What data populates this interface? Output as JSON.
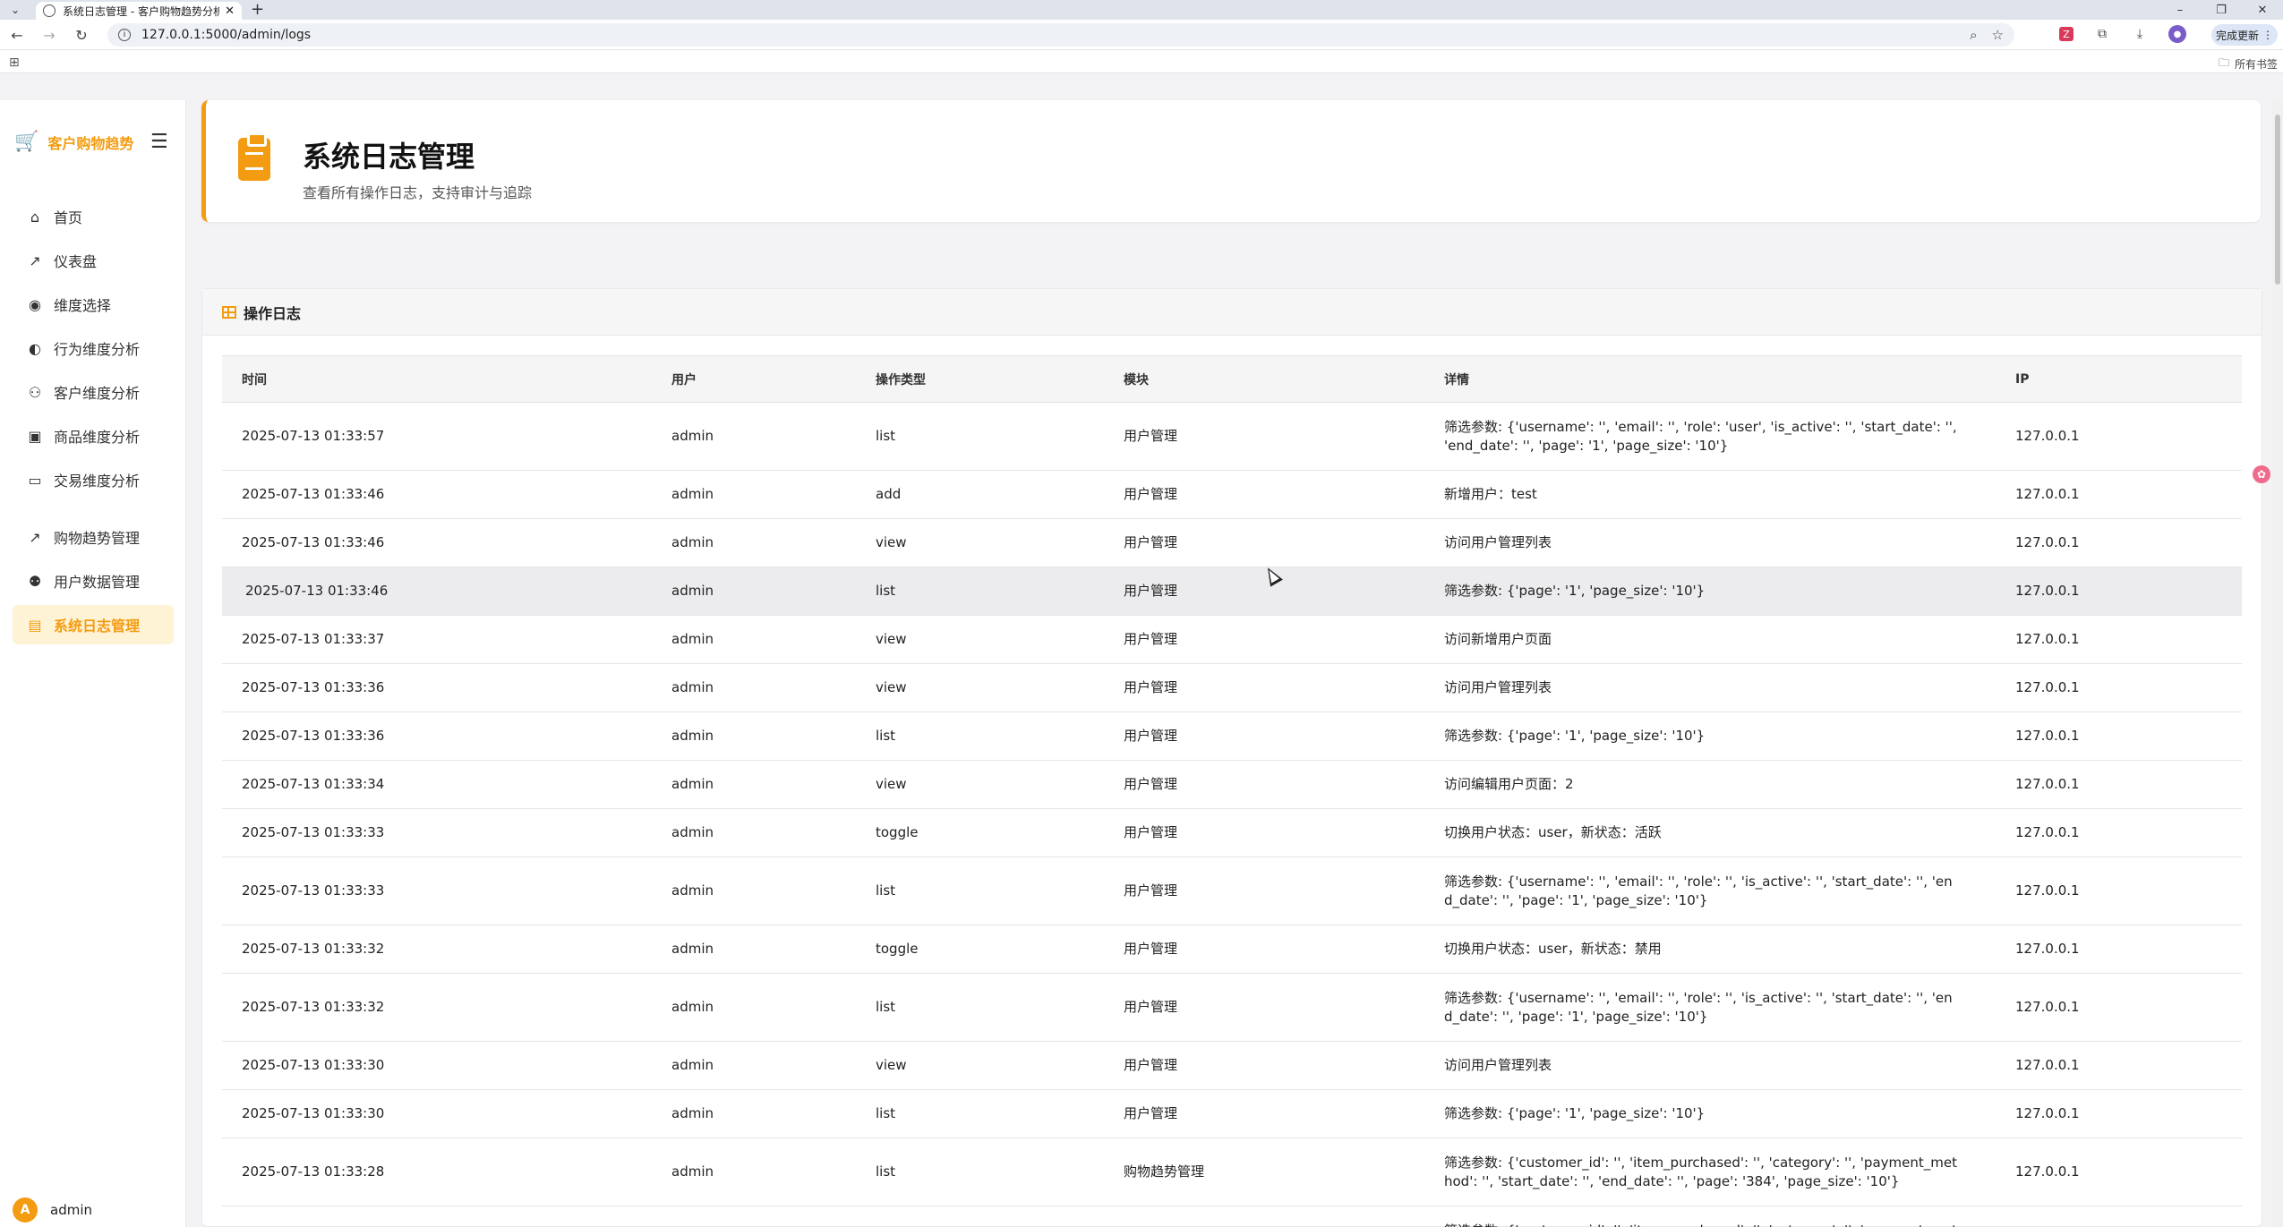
{
  "browser": {
    "tab_title": "系统日志管理 - 客户购物趋势分析",
    "tab_close": "✕",
    "new_tab": "+",
    "url": "127.0.0.1:5000/admin/logs",
    "update_label": "完成更新",
    "bookmarks_label": "所有书签"
  },
  "sidebar": {
    "brand": "客户购物趋势",
    "items": [
      {
        "label": "首页",
        "icon": "home-icon",
        "glyph": "⌂"
      },
      {
        "label": "仪表盘",
        "icon": "chart-line-icon",
        "glyph": "📈"
      },
      {
        "label": "维度选择",
        "icon": "compass-icon",
        "glyph": "◉"
      },
      {
        "label": "行为维度分析",
        "icon": "brain-icon",
        "glyph": "◐"
      },
      {
        "label": "客户维度分析",
        "icon": "users-icon",
        "glyph": "👥"
      },
      {
        "label": "商品维度分析",
        "icon": "box-icon",
        "glyph": "▣"
      },
      {
        "label": "交易维度分析",
        "icon": "credit-card-icon",
        "glyph": "▭"
      },
      {
        "label": "购物趋势管理",
        "icon": "chart-line-icon",
        "glyph": "📈"
      },
      {
        "label": "用户数据管理",
        "icon": "user-gear-icon",
        "glyph": "👤"
      },
      {
        "label": "系统日志管理",
        "icon": "clipboard-icon",
        "glyph": "▤"
      }
    ],
    "user": {
      "avatar_letter": "A",
      "name": "admin"
    }
  },
  "header": {
    "title": "系统日志管理",
    "subtitle": "查看所有操作日志，支持审计与追踪"
  },
  "panel": {
    "title": "操作日志"
  },
  "table": {
    "columns": [
      "时间",
      "用户",
      "操作类型",
      "模块",
      "详情",
      "IP"
    ],
    "rows": [
      {
        "time": "2025-07-13 01:33:57",
        "user": "admin",
        "action": "list",
        "module": "用户管理",
        "detail": "筛选参数: {'username': '', 'email': '', 'role': 'user', 'is_active': '', 'start_date': '', 'end_date': '', 'page': '1', 'page_size': '10'}",
        "ip": "127.0.0.1"
      },
      {
        "time": "2025-07-13 01:33:46",
        "user": "admin",
        "action": "add",
        "module": "用户管理",
        "detail": "新增用户：test",
        "ip": "127.0.0.1"
      },
      {
        "time": "2025-07-13 01:33:46",
        "user": "admin",
        "action": "view",
        "module": "用户管理",
        "detail": "访问用户管理列表",
        "ip": "127.0.0.1"
      },
      {
        "time": "2025-07-13 01:33:46",
        "user": "admin",
        "action": "list",
        "module": "用户管理",
        "detail": "筛选参数: {'page': '1', 'page_size': '10'}",
        "ip": "127.0.0.1"
      },
      {
        "time": "2025-07-13 01:33:37",
        "user": "admin",
        "action": "view",
        "module": "用户管理",
        "detail": "访问新增用户页面",
        "ip": "127.0.0.1"
      },
      {
        "time": "2025-07-13 01:33:36",
        "user": "admin",
        "action": "view",
        "module": "用户管理",
        "detail": "访问用户管理列表",
        "ip": "127.0.0.1"
      },
      {
        "time": "2025-07-13 01:33:36",
        "user": "admin",
        "action": "list",
        "module": "用户管理",
        "detail": "筛选参数: {'page': '1', 'page_size': '10'}",
        "ip": "127.0.0.1"
      },
      {
        "time": "2025-07-13 01:33:34",
        "user": "admin",
        "action": "view",
        "module": "用户管理",
        "detail": "访问编辑用户页面：2",
        "ip": "127.0.0.1"
      },
      {
        "time": "2025-07-13 01:33:33",
        "user": "admin",
        "action": "toggle",
        "module": "用户管理",
        "detail": "切换用户状态：user，新状态：活跃",
        "ip": "127.0.0.1"
      },
      {
        "time": "2025-07-13 01:33:33",
        "user": "admin",
        "action": "list",
        "module": "用户管理",
        "detail": "筛选参数: {'username': '', 'email': '', 'role': '', 'is_active': '', 'start_date': '', 'end_date': '', 'page': '1', 'page_size': '10'}",
        "ip": "127.0.0.1"
      },
      {
        "time": "2025-07-13 01:33:32",
        "user": "admin",
        "action": "toggle",
        "module": "用户管理",
        "detail": "切换用户状态：user，新状态：禁用",
        "ip": "127.0.0.1"
      },
      {
        "time": "2025-07-13 01:33:32",
        "user": "admin",
        "action": "list",
        "module": "用户管理",
        "detail": "筛选参数: {'username': '', 'email': '', 'role': '', 'is_active': '', 'start_date': '', 'end_date': '', 'page': '1', 'page_size': '10'}",
        "ip": "127.0.0.1"
      },
      {
        "time": "2025-07-13 01:33:30",
        "user": "admin",
        "action": "view",
        "module": "用户管理",
        "detail": "访问用户管理列表",
        "ip": "127.0.0.1"
      },
      {
        "time": "2025-07-13 01:33:30",
        "user": "admin",
        "action": "list",
        "module": "用户管理",
        "detail": "筛选参数: {'page': '1', 'page_size': '10'}",
        "ip": "127.0.0.1"
      },
      {
        "time": "2025-07-13 01:33:28",
        "user": "admin",
        "action": "list",
        "module": "购物趋势管理",
        "detail": "筛选参数: {'customer_id': '', 'item_purchased': '', 'category': '', 'payment_method': '', 'start_date': '', 'end_date': '', 'page': '384', 'page_size': '10'}",
        "ip": "127.0.0.1"
      },
      {
        "time": "",
        "user": "",
        "action": "",
        "module": "",
        "detail": "筛选参数: {'customer_id': '', 'item_purchased': '', 'category': '', 'payment_method': '', 'start",
        "ip": ""
      }
    ]
  }
}
